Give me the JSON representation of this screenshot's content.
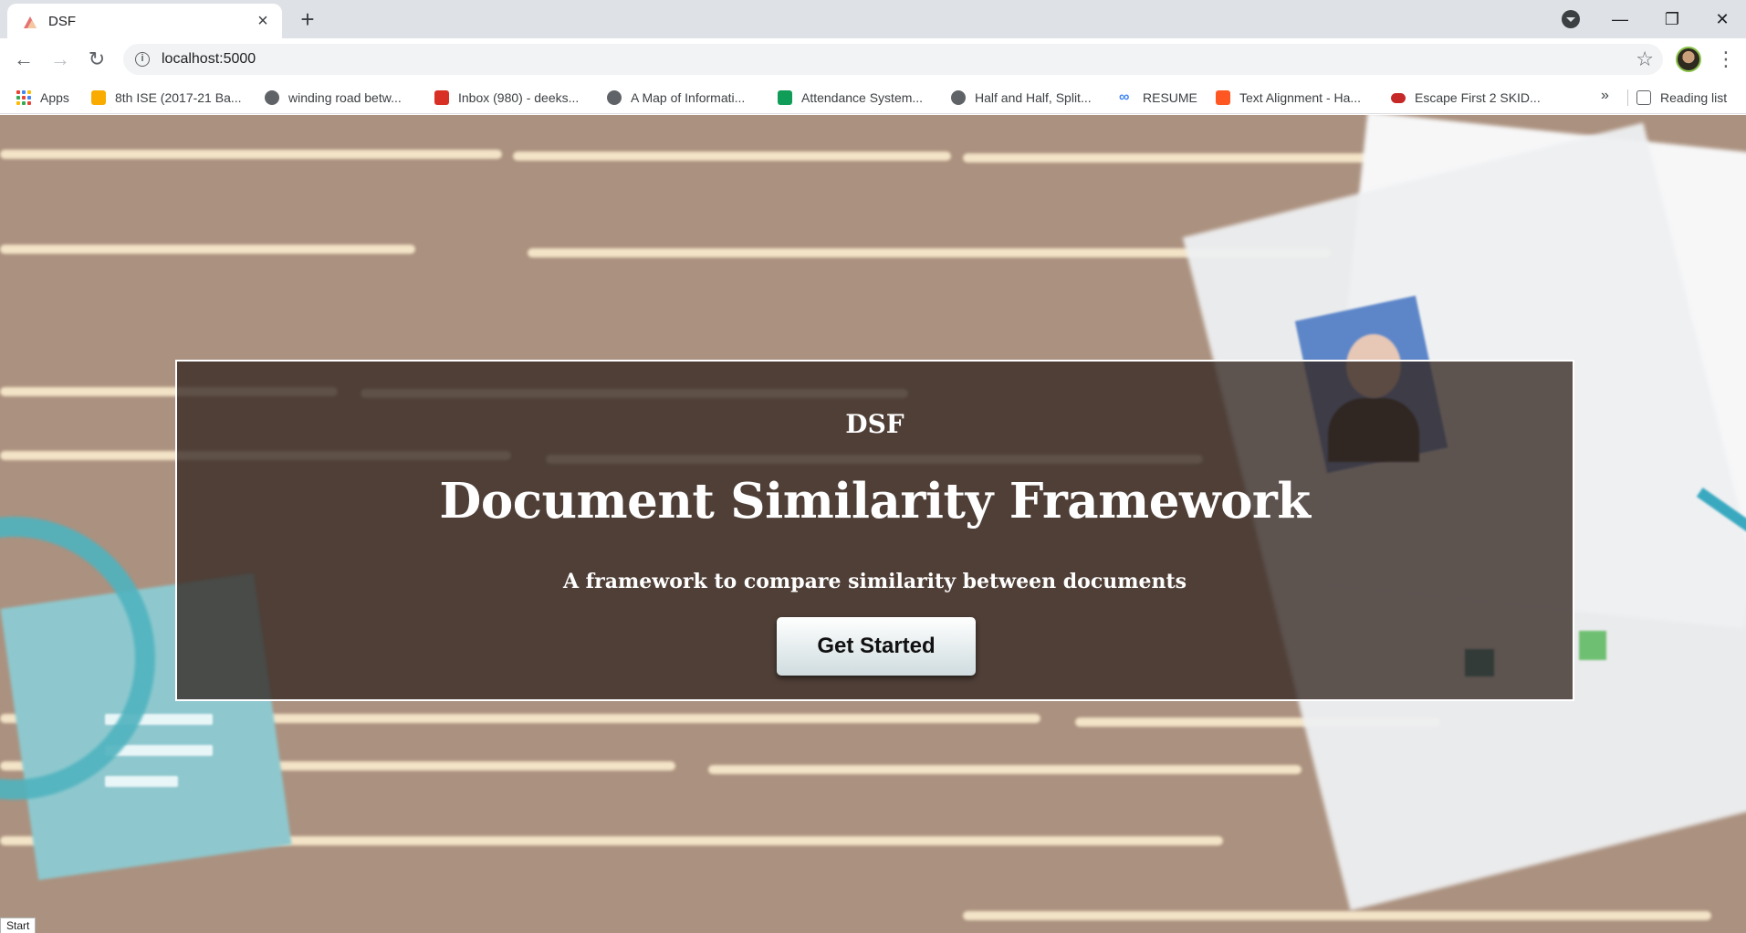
{
  "browser": {
    "tab": {
      "title": "DSF"
    },
    "address": {
      "url": "localhost:5000"
    },
    "window_controls": {
      "minimize": "—",
      "restore": "❐",
      "close": "✕"
    }
  },
  "bookmarks": [
    {
      "label": "Apps",
      "icon": "apps-grid-icon"
    },
    {
      "label": "8th ISE (2017-21 Ba...",
      "icon": "classroom-icon",
      "color": "#f9ab00"
    },
    {
      "label": "winding road betw...",
      "icon": "globe-icon"
    },
    {
      "label": "Inbox (980) - deeks...",
      "icon": "gmail-icon",
      "color": "#d93025"
    },
    {
      "label": "A Map of Informati...",
      "icon": "globe-icon"
    },
    {
      "label": "Attendance System...",
      "icon": "sheets-icon",
      "color": "#0f9d58"
    },
    {
      "label": "Half and Half, Split...",
      "icon": "globe-icon"
    },
    {
      "label": "RESUME",
      "icon": "infinity-icon"
    },
    {
      "label": "Text Alignment - Ha...",
      "icon": "blogger-icon",
      "color": "#ff5722"
    },
    {
      "label": "Escape First 2 SKID...",
      "icon": "gamepad-icon",
      "color": "#c62828"
    }
  ],
  "bookmarks_overflow": "»",
  "reading_list": "Reading list",
  "hero": {
    "brand": "DSF",
    "title": "Document Similarity Framework",
    "subtitle": "A framework to compare similarity between documents",
    "cta_label": "Get Started"
  },
  "status_bar": "Start"
}
